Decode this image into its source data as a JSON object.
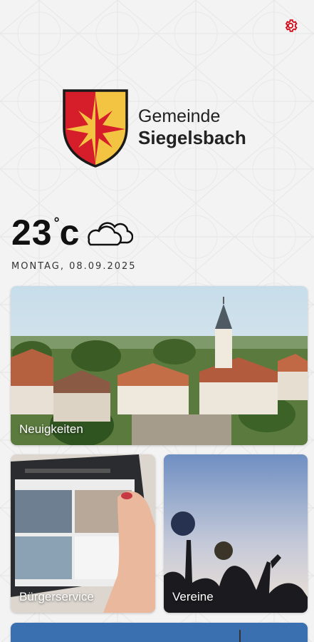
{
  "header": {
    "settings_icon": "gear-icon",
    "accent_color": "#d0101e"
  },
  "logo": {
    "line1": "Gemeinde",
    "line2": "Siegelsbach",
    "crest_colors": {
      "red": "#d51e2a",
      "gold": "#f3c442",
      "outline": "#1a1a1a"
    }
  },
  "weather": {
    "temperature": "23",
    "degree_symbol": "°",
    "unit": "c",
    "icon": "cloud-icon",
    "date": "MONTAG, 08.09.2025"
  },
  "tiles": [
    {
      "label": "Neuigkeiten",
      "icon": "village-photo"
    },
    {
      "label": "Bürgerservice",
      "icon": "tablet-photo"
    },
    {
      "label": "Vereine",
      "icon": "balloon-photo"
    }
  ]
}
